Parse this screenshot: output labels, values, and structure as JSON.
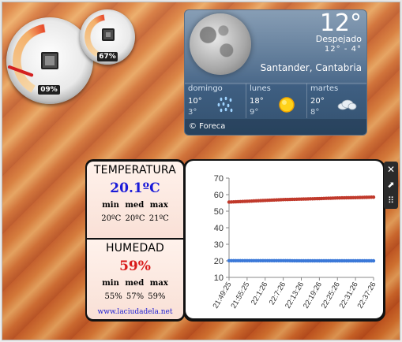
{
  "cpu_meter": {
    "value": "09%",
    "load": 0.09
  },
  "ram_meter": {
    "value": "67%",
    "load": 0.67
  },
  "weather": {
    "temperature": "12°",
    "condition": "Despejado",
    "range_high": "12°",
    "range_sep": "-",
    "range_low": "4°",
    "location": "Santander, Cantabria",
    "footer": "© Foreca",
    "forecast": [
      {
        "day": "domingo",
        "high": "10°",
        "low": "3°",
        "icon": "rain-icon"
      },
      {
        "day": "lunes",
        "high": "18°",
        "low": "9°",
        "icon": "sun-icon"
      },
      {
        "day": "martes",
        "high": "20°",
        "low": "8°",
        "icon": "cloud-icon"
      }
    ]
  },
  "sensor": {
    "temperature": {
      "title": "TEMPERATURA",
      "value": "20.1ºC",
      "header": "min med max",
      "stats": "20ºC 20ºC 21ºC"
    },
    "humidity": {
      "title": "HUMEDAD",
      "value": "59%",
      "header": "min med max",
      "stats": "55% 57% 59%"
    },
    "link": "www.laciudadela.net",
    "value_color": "#1a1ad8",
    "humidity_color": "#d81a1a"
  },
  "chart_data": {
    "type": "line",
    "categories": [
      "21:49:25",
      "21:55:25",
      "22:1:26",
      "22:7:26",
      "22:13:26",
      "22:19:26",
      "22:25:26",
      "22:31:26",
      "22:37:26"
    ],
    "ylim": [
      10,
      70
    ],
    "yticks": [
      10,
      20,
      30,
      40,
      50,
      60,
      70
    ],
    "grid": false,
    "legend": "none",
    "series": [
      {
        "color": "#c0392b",
        "values": [
          55.5,
          56.0,
          56.5,
          57.0,
          57.3,
          57.6,
          58.0,
          58.2,
          58.5
        ]
      },
      {
        "color": "#3a78d8",
        "values": [
          20.1,
          20.1,
          20.1,
          20.1,
          20.0,
          20.0,
          20.0,
          20.0,
          20.0
        ]
      }
    ]
  },
  "toolbar": {
    "close_glyph": "✕",
    "options_glyph": "⬈",
    "drag_glyph": "⠿"
  }
}
